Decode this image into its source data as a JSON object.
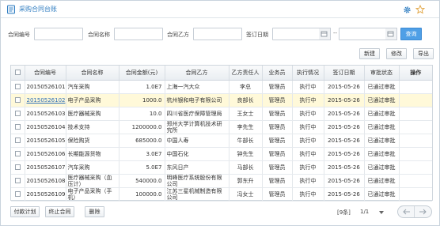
{
  "header": {
    "title": "采购合同台账",
    "icons": {
      "title": "document-icon",
      "settings": "gear-icon",
      "favorite": "star-icon"
    },
    "accent_color": "#2f7dc1"
  },
  "search": {
    "contract_no_label": "合同编号",
    "contract_no_value": "",
    "contract_name_label": "合同名称",
    "contract_name_value": "",
    "party_b_label": "合同乙方",
    "party_b_value": "",
    "sign_date_label": "签订日期",
    "date_from": "",
    "date_to": "",
    "date_separator": "--",
    "search_button": "查询",
    "search_button_color": "#4f9fe6"
  },
  "toolbar": {
    "new_label": "新建",
    "edit_label": "修改",
    "export_label": "导出"
  },
  "table": {
    "headers": [
      "合同编号",
      "合同名称",
      "合同金额(元)",
      "合同乙方",
      "乙方责任人",
      "业务员",
      "执行情况",
      "签订日期",
      "审批状态",
      "操作"
    ],
    "rows": [
      {
        "code": "20150526101",
        "name": "汽车采购",
        "amount": "1.0E7",
        "party": "上海一汽大众",
        "contact": "李总",
        "sales": "管理员",
        "status": "执行中",
        "date": "2015-05-26",
        "approval": "已通过审批",
        "selected": false
      },
      {
        "code": "20150526102",
        "name": "电子产品采购",
        "amount": "1000.0",
        "party": "杭州银和电子有限公司",
        "contact": "良部长",
        "sales": "管理员",
        "status": "执行中",
        "date": "2015-05-26",
        "approval": "已通过审批",
        "selected": true
      },
      {
        "code": "20150526103",
        "name": "医疗器械采购",
        "amount": "10.0",
        "party": "四川省医疗保障管理局",
        "contact": "王女士",
        "sales": "管理员",
        "status": "执行中",
        "date": "2015-05-26",
        "approval": "已通过审批",
        "selected": false
      },
      {
        "code": "20150526104",
        "name": "技术支持",
        "amount": "1200000.0",
        "party": "郑州大学计算机技术研究所",
        "contact": "李先生",
        "sales": "管理员",
        "status": "执行中",
        "date": "2015-05-26",
        "approval": "已通过审批",
        "selected": false
      },
      {
        "code": "20150526105",
        "name": "保险购货",
        "amount": "685000.0",
        "party": "中国人寿",
        "contact": "牛部长",
        "sales": "管理员",
        "status": "执行中",
        "date": "2015-05-26",
        "approval": "已通过审批",
        "selected": false
      },
      {
        "code": "20150526106",
        "name": "长期能源货物",
        "amount": "3.0E7",
        "party": "中国石化",
        "contact": "钟先生",
        "sales": "管理员",
        "status": "执行中",
        "date": "2015-05-26",
        "approval": "已通过审批",
        "selected": false
      },
      {
        "code": "20150526107",
        "name": "汽车采购",
        "amount": "5.0E7",
        "party": "东风日产",
        "contact": "马部长",
        "sales": "管理员",
        "status": "执行中",
        "date": "2015-05-26",
        "approval": "已通过审批",
        "selected": false
      },
      {
        "code": "20150526108",
        "name": "医疗器械采购（血压计）",
        "amount": "540000.0",
        "party": "明峰医疗系统股份有限公司",
        "contact": "郭东升",
        "sales": "管理员",
        "status": "执行中",
        "date": "2015-05-26",
        "approval": "已通过审批",
        "selected": false
      },
      {
        "code": "20150526109",
        "name": "电子产品采购（手机）",
        "amount": "100000.0",
        "party": "江苏三星机械制造有限公司",
        "contact": "冯女士",
        "sales": "管理员",
        "status": "执行中",
        "date": "2015-05-26",
        "approval": "已通过审批",
        "selected": false
      }
    ],
    "selected_row_color": "#fff9d9"
  },
  "footer": {
    "payment_plan_label": "付款计划",
    "terminate_label": "终止合同",
    "delete_label": "删除",
    "total_text": "[9条]",
    "page_text": "1/1"
  }
}
